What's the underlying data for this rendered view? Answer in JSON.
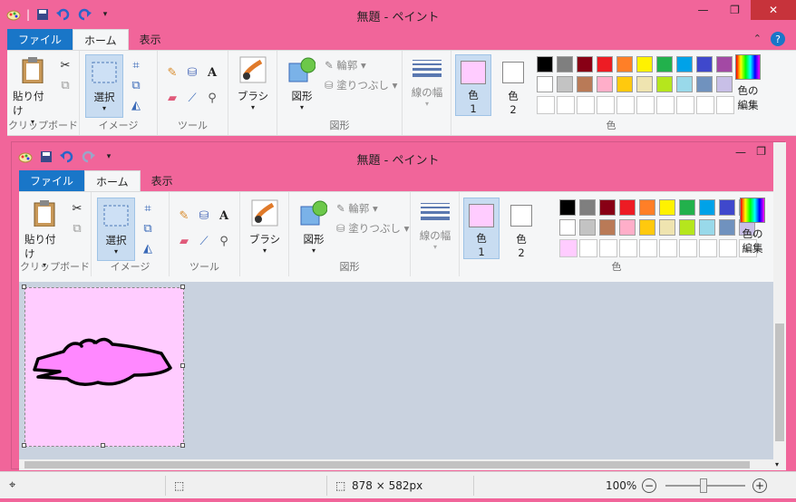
{
  "window": {
    "title": "無題 - ペイント",
    "minimize_icon": "minimize-icon",
    "maximize_icon": "maximize-icon",
    "close_icon": "close-icon"
  },
  "tabs": [
    {
      "label": "ファイル"
    },
    {
      "label": "ホーム"
    },
    {
      "label": "表示"
    }
  ],
  "ribbon": {
    "clipboard": {
      "paste": "貼り付け",
      "group": "クリップボード"
    },
    "image": {
      "select": "選択",
      "group": "イメージ"
    },
    "tools": {
      "group": "ツール"
    },
    "brush": {
      "label": "ブラシ"
    },
    "shapes": {
      "label": "図形",
      "outline": "輪郭",
      "fill": "塗りつぶし",
      "group": "図形"
    },
    "size": {
      "label": "線の幅"
    },
    "colors": {
      "color1": "色",
      "color1_num": "1",
      "color2": "色",
      "color2_num": "2",
      "edit": "色の編集",
      "edit_line1": "色の",
      "edit_line2": "編集",
      "group": "色",
      "color1_hex": "#ffccff",
      "color2_hex": "#ffffff",
      "palette": [
        "#000000",
        "#7f7f7f",
        "#880015",
        "#ed1c24",
        "#ff7f27",
        "#fff200",
        "#22b14c",
        "#00a2e8",
        "#3f48cc",
        "#a349a4",
        "#ffffff",
        "#c3c3c3",
        "#b97a57",
        "#ffaec9",
        "#ffc90e",
        "#efe4b0",
        "#b5e61d",
        "#99d9ea",
        "#7092be",
        "#c8bfe7"
      ]
    }
  },
  "inner_window": {
    "title": "無題 - ペイント"
  },
  "status": {
    "size": "878 × 582px",
    "zoom": "100%"
  }
}
